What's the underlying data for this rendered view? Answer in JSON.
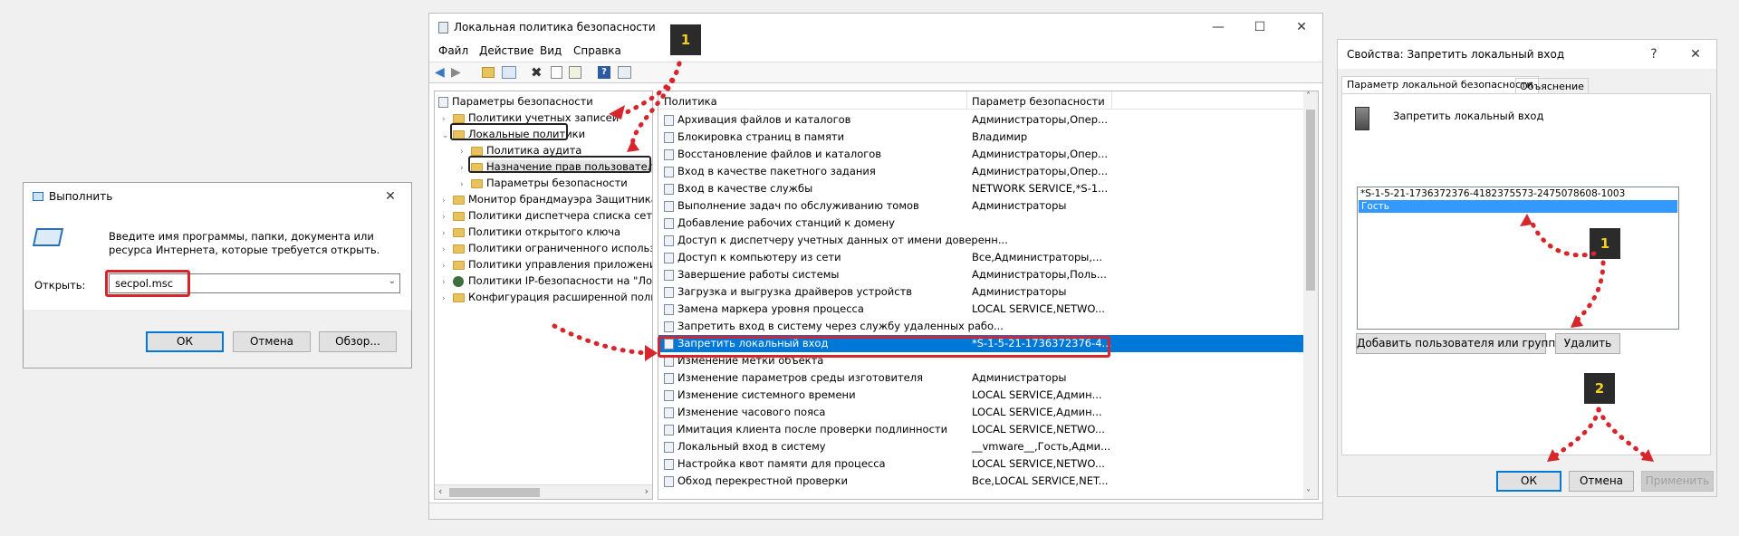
{
  "run": {
    "title": "Выполнить",
    "desc": "Введите имя программы, папки, документа или ресурса Интернета, которые требуется открыть.",
    "open_label": "Открыть:",
    "value": "secpol.msc",
    "ok": "ОК",
    "cancel": "Отмена",
    "browse": "Обзор..."
  },
  "secpol": {
    "title": "Локальная политика безопасности",
    "menu": [
      "Файл",
      "Действие",
      "Вид",
      "Справка"
    ],
    "tree": [
      "Параметры безопасности",
      "Политики учетных записей",
      "Локальные политики",
      "Политика аудита",
      "Назначение прав пользователя",
      "Параметры безопасности",
      "Монитор брандмауэра Защитника W",
      "Политики диспетчера списка сетей",
      "Политики открытого ключа",
      "Политики ограниченного использо",
      "Политики управления приложения",
      "Политики IP-безопасности на \"Лока",
      "Конфигурация расширенной полит"
    ],
    "col_policy": "Политика",
    "col_setting": "Параметр безопасности",
    "rows": [
      [
        "Архивация файлов и каталогов",
        "Администраторы,Опер..."
      ],
      [
        "Блокировка страниц в памяти",
        "Владимир"
      ],
      [
        "Восстановление файлов и каталогов",
        "Администраторы,Опер..."
      ],
      [
        "Вход в качестве пакетного задания",
        "Администраторы,Опер..."
      ],
      [
        "Вход в качестве службы",
        "NETWORK SERVICE,*S-1..."
      ],
      [
        "Выполнение задач по обслуживанию томов",
        "Администраторы"
      ],
      [
        "Добавление рабочих станций к домену",
        ""
      ],
      [
        "Доступ к диспетчеру учетных данных от имени доверенн...",
        ""
      ],
      [
        "Доступ к компьютеру из сети",
        "Все,Администраторы,..."
      ],
      [
        "Завершение работы системы",
        "Администраторы,Поль..."
      ],
      [
        "Загрузка и выгрузка драйверов устройств",
        "Администраторы"
      ],
      [
        "Замена маркера уровня процесса",
        "LOCAL SERVICE,NETWO..."
      ],
      [
        "Запретить вход в систему через службу удаленных рабо...",
        ""
      ],
      [
        "Запретить локальный вход",
        "*S-1-5-21-1736372376-4..."
      ],
      [
        "Изменение метки объекта",
        ""
      ],
      [
        "Изменение параметров среды изготовителя",
        "Администраторы"
      ],
      [
        "Изменение системного времени",
        "LOCAL SERVICE,Админ..."
      ],
      [
        "Изменение часового пояса",
        "LOCAL SERVICE,Админ..."
      ],
      [
        "Имитация клиента после проверки подлинности",
        "LOCAL SERVICE,NETWO..."
      ],
      [
        "Локальный вход в систему",
        "__vmware__,Гость,Адми..."
      ],
      [
        "Настройка квот памяти для процесса",
        "LOCAL SERVICE,NETWO..."
      ],
      [
        "Обход перекрестной проверки",
        "Все,LOCAL SERVICE,NET..."
      ]
    ],
    "badge": "1"
  },
  "props": {
    "title": "Свойства: Запретить локальный вход",
    "help": "?",
    "tab1": "Параметр локальной безопасности",
    "tab2": "Объяснение",
    "heading": "Запретить локальный вход",
    "list": [
      "*S-1-5-21-1736372376-4182375573-2475078608-1003",
      "Гость"
    ],
    "add": "Добавить пользователя или группу...",
    "remove": "Удалить",
    "ok": "ОК",
    "cancel": "Отмена",
    "apply": "Применить",
    "badge1": "1",
    "badge2": "2"
  },
  "colors": {
    "accent": "#0078d7",
    "highlight": "#3399ff",
    "marker": "#d6262b"
  }
}
